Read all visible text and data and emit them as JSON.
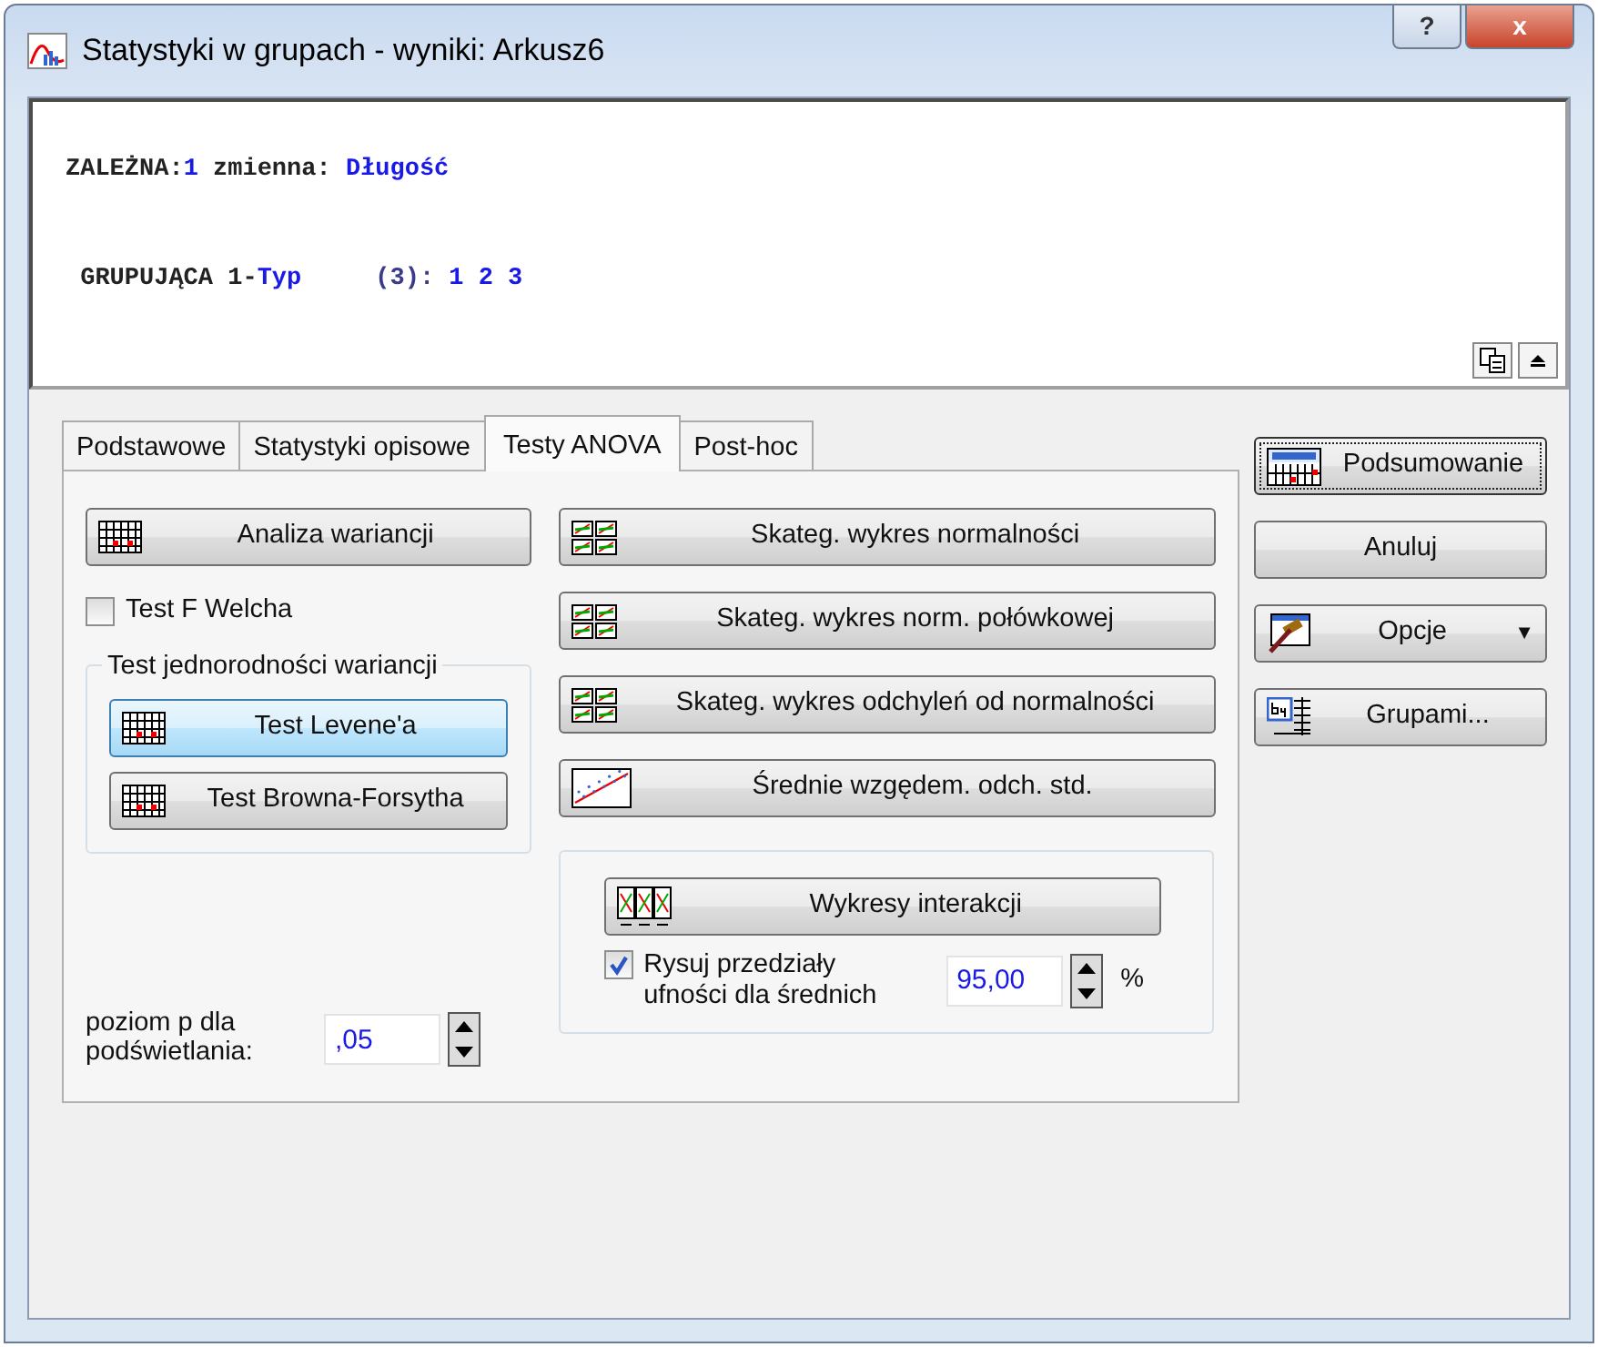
{
  "window": {
    "title": "Statystyki w grupach - wyniki: Arkusz6",
    "help": "?",
    "close": "x"
  },
  "info": {
    "lines": [
      [
        {
          "text": "ZALEŻNA:",
          "kind": "label"
        },
        {
          "text": "1",
          "kind": "value"
        },
        {
          "text": " zmienna: ",
          "kind": "label"
        },
        {
          "text": "Długość",
          "kind": "value"
        }
      ],
      [
        {
          "text": " GRUPUJĄCA 1-",
          "kind": "label"
        },
        {
          "text": "Typ",
          "kind": "value"
        },
        {
          "text": "     (3): ",
          "kind": "count"
        },
        {
          "text": "1 2 3",
          "kind": "value"
        }
      ]
    ],
    "buttons": [
      {
        "kind": "copy"
      },
      {
        "kind": "up"
      }
    ]
  },
  "tabs": [
    {
      "label": "Podstawowe",
      "selected": false
    },
    {
      "label": "Statystyki opisowe",
      "selected": false
    },
    {
      "label": "Testy ANOVA",
      "selected": true
    },
    {
      "label": "Post-hoc",
      "selected": false
    }
  ],
  "left": {
    "main_button": {
      "label": "Analiza wariancji",
      "kind": "table"
    },
    "welch": {
      "label": "Test F Welcha",
      "checked": false
    },
    "group": {
      "title": "Test jednorodności wariancji",
      "buttons": [
        {
          "label": "Test Levene'a",
          "kind": "table",
          "highlighted": true
        },
        {
          "label": "Test Browna-Forsytha",
          "kind": "table",
          "highlighted": false
        }
      ]
    },
    "p_level": {
      "label": "poziom p dla podświetlania:",
      "value": ",05"
    }
  },
  "middle": {
    "buttons": [
      {
        "label": "Skateg. wykres normalności",
        "kind": "quad"
      },
      {
        "label": "Skateg. wykres norm. połówkowej",
        "kind": "quad"
      },
      {
        "label": "Skateg. wykres odchyleń od normalności",
        "kind": "quad"
      },
      {
        "label": "Średnie wzgędem. odch. std.",
        "kind": "scatter"
      }
    ],
    "interaction": {
      "button": {
        "label": "Wykresy interakcji",
        "kind": "interaction"
      },
      "ci": {
        "label": "Rysuj przedziały ufności dla średnich",
        "checked": true
      },
      "value": "95,00",
      "unit": "%"
    }
  },
  "side_buttons": [
    {
      "label": "Podsumowanie",
      "kind": "summary",
      "default": true
    },
    {
      "label": "Anuluj",
      "default": false
    },
    {
      "label": "Opcje",
      "kind": "hammer",
      "default": false,
      "dropdown": "▼"
    },
    {
      "label": "Grupami...",
      "kind": "by",
      "default": false
    }
  ]
}
